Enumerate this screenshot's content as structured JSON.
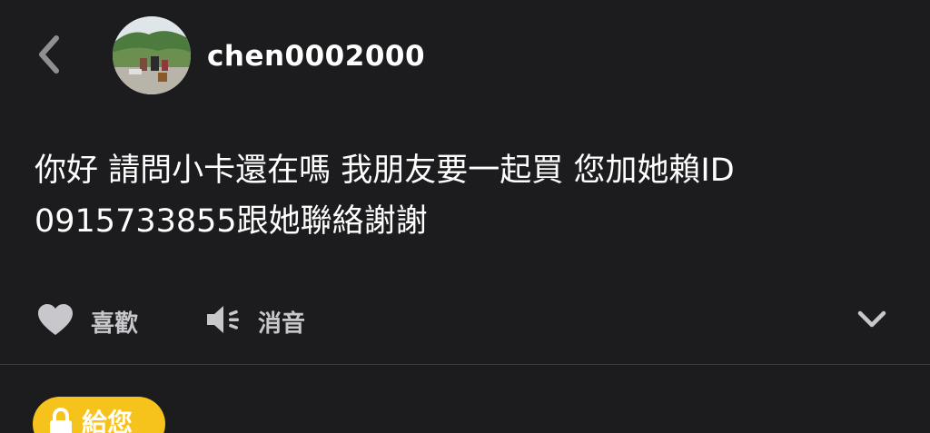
{
  "header": {
    "back_icon": "chevron-left-icon",
    "avatar_icon": "avatar-photo",
    "username": "chen0002000"
  },
  "message": {
    "text": "你好 請問小卡還在嗎 我朋友要一起買 您加她賴ID\n0915733855跟她聯絡謝謝"
  },
  "actions": {
    "like_icon": "heart-icon",
    "like_label": "喜歡",
    "mute_icon": "speaker-mute-icon",
    "mute_label": "消音",
    "expand_icon": "chevron-down-icon"
  },
  "footer": {
    "gift_icon": "lock-icon",
    "gift_label": "給您"
  },
  "colors": {
    "background": "#1c1c1e",
    "text": "#ffffff",
    "muted": "#c7c7cc",
    "accent": "#f6c21c"
  }
}
